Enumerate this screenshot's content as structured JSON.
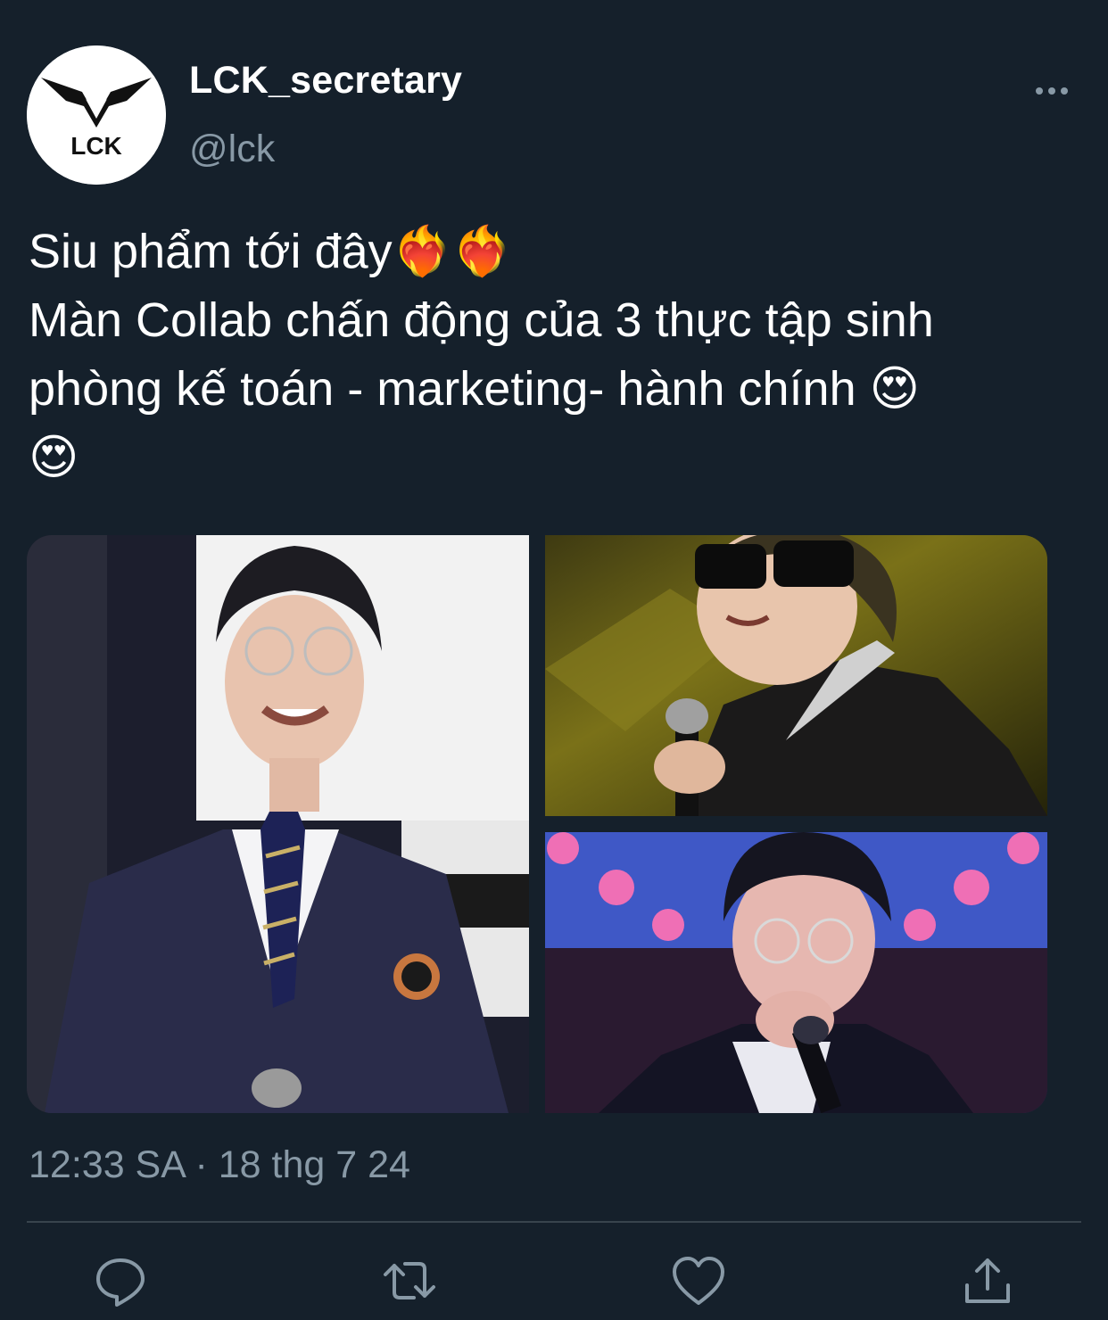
{
  "tweet": {
    "author_name": "LCK_secretary",
    "author_handle": "@lck",
    "avatar_text": "LCK",
    "text_lines": [
      "Siu phẩm tới đây❤️‍🔥❤️‍🔥",
      "Màn Collab chấn động của 3 thực tập sinh",
      "phòng kế toán - marketing- hành chính 😍",
      "😍"
    ],
    "timestamp": "12:33 SA · 18 thg 7 24",
    "media_count": 3,
    "icons": {
      "more": "more-icon",
      "reply": "reply-icon",
      "retweet": "retweet-icon",
      "like": "like-icon",
      "share": "share-icon"
    }
  },
  "colors": {
    "background": "#15202b",
    "secondary_text": "#8899a6",
    "divider": "#38444d"
  }
}
